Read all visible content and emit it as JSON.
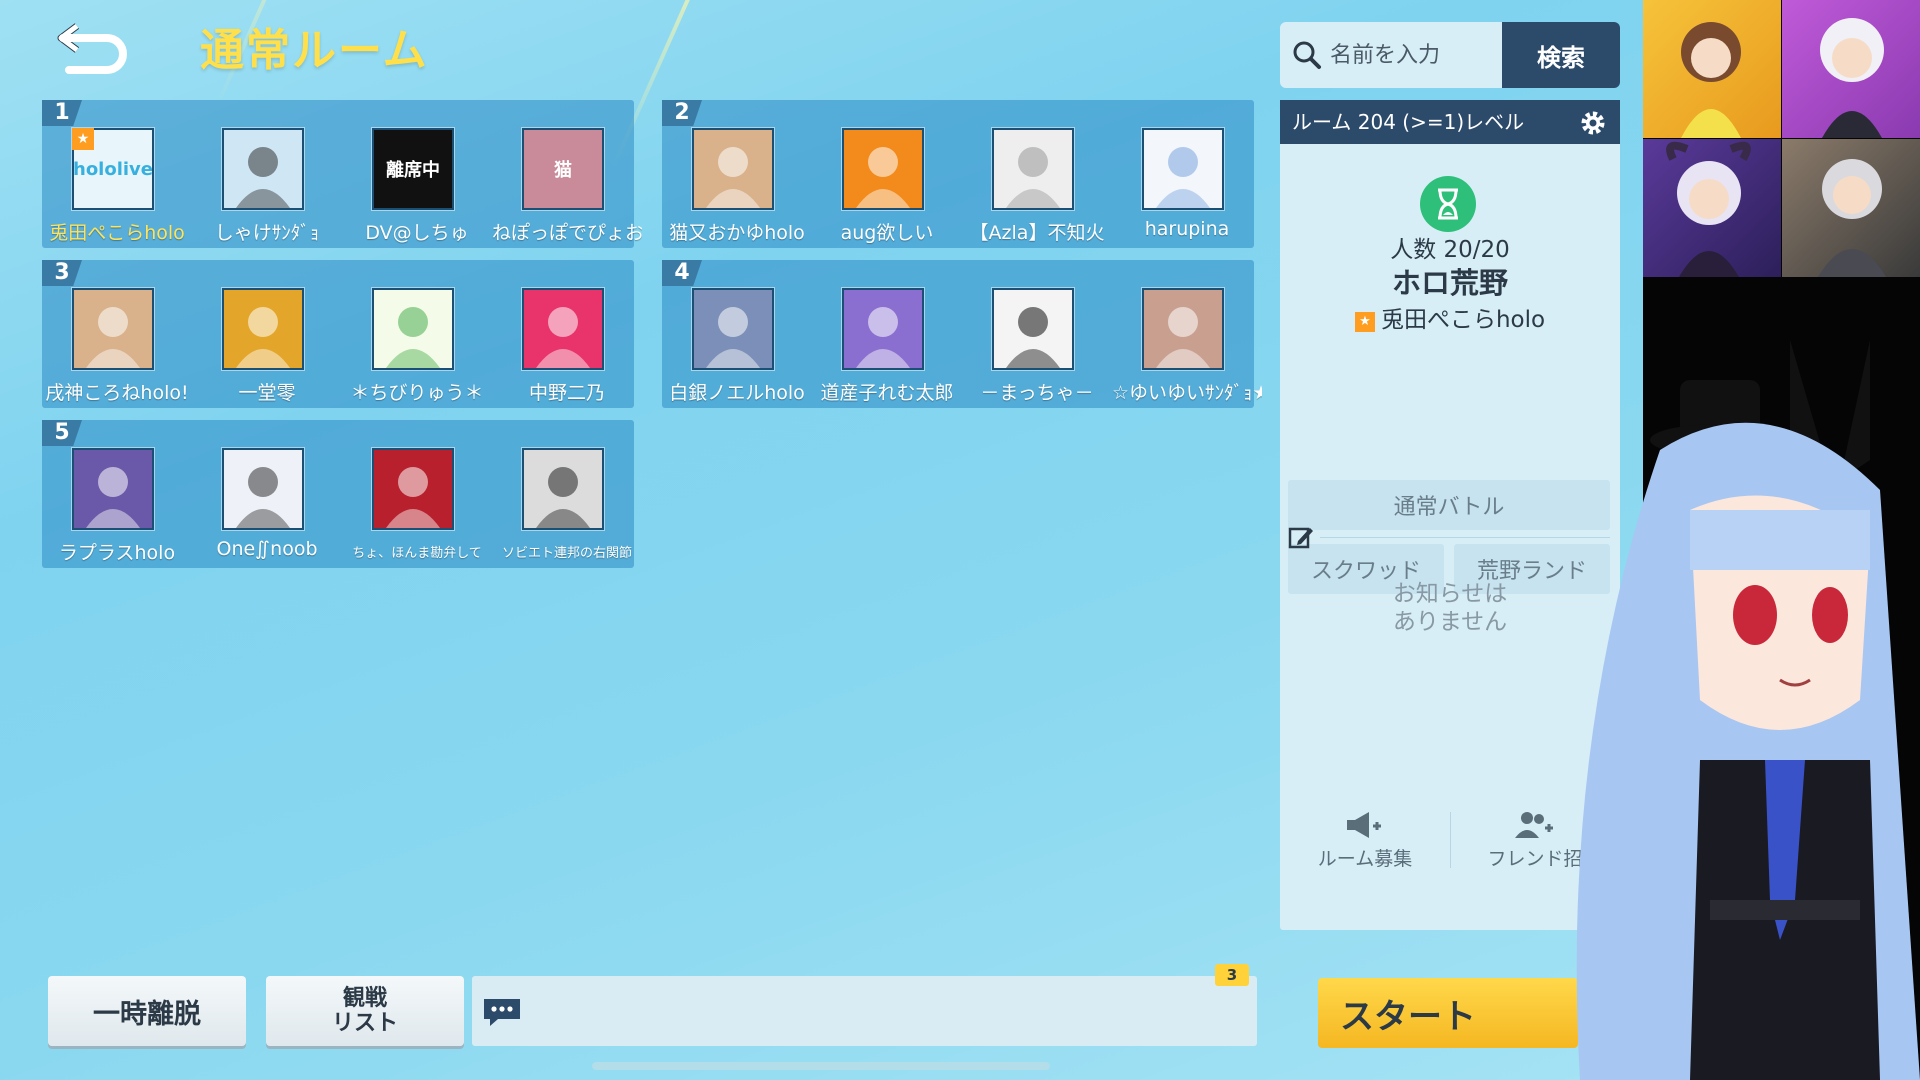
{
  "header": {
    "title": "通常ルーム"
  },
  "teams": [
    {
      "number": "1",
      "players": [
        {
          "name": "兎田ぺこらholo",
          "host": true,
          "avatar_text": "hololive",
          "avatar_bg": "#e8f6fb",
          "avatar_fg": "#37b0e0"
        },
        {
          "name": "しゃけｻﾝﾀﾞｮ",
          "host": false,
          "avatar_text": "",
          "avatar_bg": "#cfe6f5",
          "avatar_fg": "#333"
        },
        {
          "name": "DV@しちゅ",
          "host": false,
          "avatar_text": "離席中",
          "avatar_bg": "#111111",
          "avatar_fg": "#ffffff"
        },
        {
          "name": "ねぽっぽでぴょお~",
          "host": false,
          "avatar_text": "猫",
          "avatar_bg": "#c98a9a",
          "avatar_fg": "#fff"
        }
      ]
    },
    {
      "number": "2",
      "players": [
        {
          "name": "猫又おかゆholo",
          "host": false,
          "avatar_text": "",
          "avatar_bg": "#d9b18a",
          "avatar_fg": "#fff"
        },
        {
          "name": "aug欲しい",
          "host": false,
          "avatar_text": "",
          "avatar_bg": "#f28a1c",
          "avatar_fg": "#fff"
        },
        {
          "name": "【Azla】不知火",
          "host": false,
          "avatar_text": "",
          "avatar_bg": "#eeeeee",
          "avatar_fg": "#999"
        },
        {
          "name": "harupina",
          "host": false,
          "avatar_text": "",
          "avatar_bg": "#f3f6fb",
          "avatar_fg": "#7aa6e0"
        }
      ]
    },
    {
      "number": "3",
      "players": [
        {
          "name": "戌神ころねholo!",
          "host": false,
          "avatar_text": "",
          "avatar_bg": "#d9b18a",
          "avatar_fg": "#fff"
        },
        {
          "name": "一堂零",
          "host": false,
          "avatar_text": "",
          "avatar_bg": "#e3a62a",
          "avatar_fg": "#fff"
        },
        {
          "name": "＊ちびりゅう＊",
          "host": false,
          "avatar_text": "",
          "avatar_bg": "#f4fbe8",
          "avatar_fg": "#4caf50"
        },
        {
          "name": "中野二乃",
          "host": false,
          "avatar_text": "",
          "avatar_bg": "#e8336b",
          "avatar_fg": "#fff"
        }
      ]
    },
    {
      "number": "4",
      "players": [
        {
          "name": "白銀ノエルholo",
          "host": false,
          "avatar_text": "",
          "avatar_bg": "#7b8fb8",
          "avatar_fg": "#fff"
        },
        {
          "name": "道産子れむ太郎",
          "host": false,
          "avatar_text": "",
          "avatar_bg": "#8a6fd0",
          "avatar_fg": "#fff"
        },
        {
          "name": "－まっちゃ－",
          "host": false,
          "avatar_text": "",
          "avatar_bg": "#f4f4f4",
          "avatar_fg": "#111"
        },
        {
          "name": "☆ゆいゆいｻﾝﾀﾞｮ★",
          "host": false,
          "avatar_text": "",
          "avatar_bg": "#c9a090",
          "avatar_fg": "#fff"
        }
      ]
    },
    {
      "number": "5",
      "players": [
        {
          "name": "ラプラスholo",
          "host": false,
          "avatar_text": "",
          "avatar_bg": "#6a58a8",
          "avatar_fg": "#fff"
        },
        {
          "name": "One∬noob",
          "host": false,
          "avatar_text": "",
          "avatar_bg": "#eef2f8",
          "avatar_fg": "#333"
        },
        {
          "name": "ちょ、ほんま勘弁して",
          "host": false,
          "avatar_text": "",
          "avatar_bg": "#b7202c",
          "avatar_fg": "#fff",
          "small": true
        },
        {
          "name": "ソビエト連邦の右関節",
          "host": false,
          "avatar_text": "",
          "avatar_bg": "#dcdcdc",
          "avatar_fg": "#222",
          "small": true
        }
      ]
    }
  ],
  "search": {
    "placeholder": "名前を入力",
    "button_label": "検索"
  },
  "room": {
    "header": "ルーム 204 (>=1)レベル",
    "count": "人数 20/20",
    "name": "ホロ荒野",
    "host": "兎田ぺこらholo",
    "mode_main": "通常バトル",
    "mode_squad": "スクワッド",
    "mode_land": "荒野ランド",
    "notice_line1": "お知らせは",
    "notice_line2": "ありません",
    "recruit_label": "ルーム募集",
    "friend_label": "フレンド招"
  },
  "bottom": {
    "leave_label": "一時離脱",
    "watch_line1": "観戦",
    "watch_line2": "リスト",
    "chat_badge": "3",
    "start_label": "スタート"
  },
  "colors": {
    "accent_yellow": "#ffe04a",
    "panel_dark": "#2c4a6a",
    "team_bg": "#2c8ac4"
  }
}
